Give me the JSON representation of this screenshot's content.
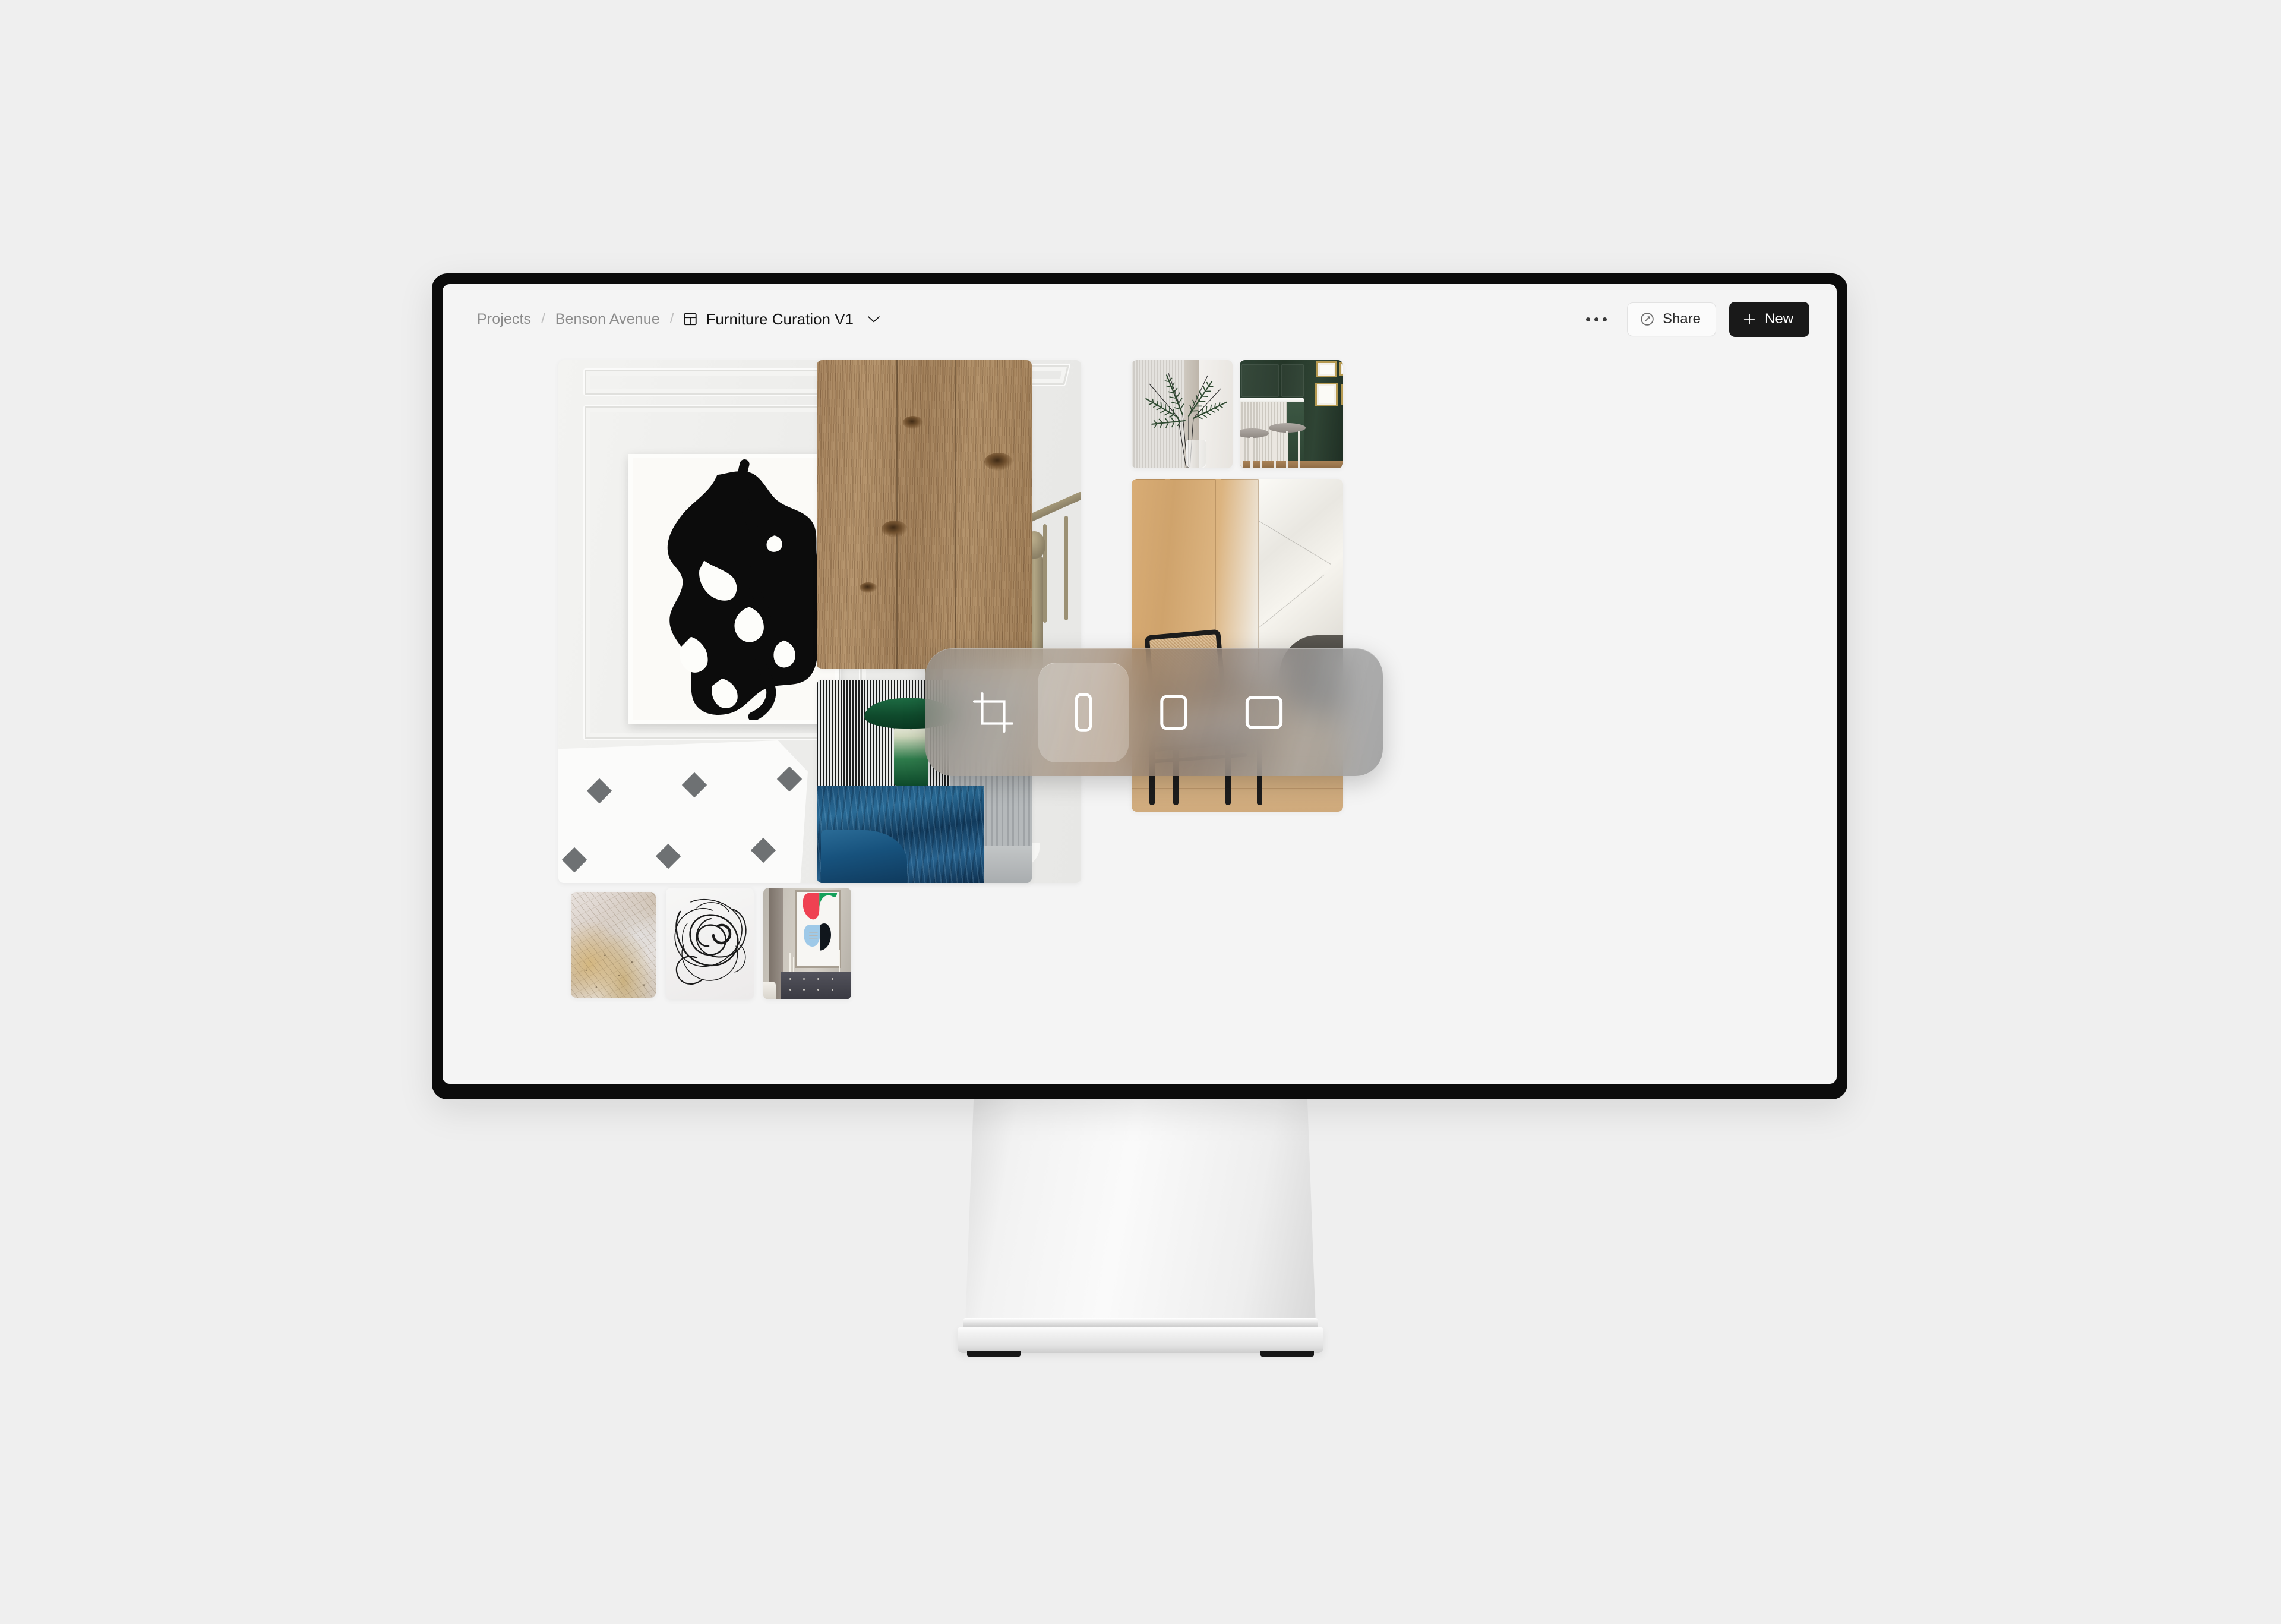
{
  "app": {
    "window_title": "Furniture Curation V1"
  },
  "topbar": {
    "breadcrumb": {
      "items": [
        {
          "label": "Projects",
          "current": false
        },
        {
          "label": "Benson Avenue",
          "current": false
        },
        {
          "label": "Furniture Curation V1",
          "current": true
        }
      ],
      "separator": "/",
      "current_icon": "layout-grid-icon",
      "dropdown_icon": "chevron-down-icon"
    },
    "more_menu": {
      "icon": "ellipsis-icon",
      "label": "More options"
    },
    "share": {
      "label": "Share",
      "icon": "link-icon"
    },
    "new": {
      "label": "New",
      "icon": "plus-icon",
      "background": "#191919",
      "text_color": "#ffffff"
    }
  },
  "floating_toolbar": {
    "items": [
      {
        "id": "crop",
        "icon": "crop-icon",
        "label": "Crop",
        "active": false
      },
      {
        "id": "ratio-tall",
        "icon": "rectangle-tall-icon",
        "label": "Tall aspect ratio",
        "active": true
      },
      {
        "id": "ratio-portrait",
        "icon": "rectangle-portrait-icon",
        "label": "Portrait aspect ratio",
        "active": false
      },
      {
        "id": "ratio-square",
        "icon": "rectangle-square-icon",
        "label": "Square aspect ratio",
        "active": false
      }
    ]
  },
  "board": {
    "cards": [
      {
        "id": "hall",
        "name": "white-hallway-interior",
        "alt": "White panelled hallway with large black abstract painting, brass wall sconce, brass staircase railing and diamond tile floor"
      },
      {
        "id": "wood",
        "name": "oak-wood-flooring-sample",
        "alt": "Light oak wood flooring plank sample with vertical grain"
      },
      {
        "id": "fern",
        "name": "fern-in-glass-vase",
        "alt": "Fern fronds in a clear glass vase against a fluted white wall"
      },
      {
        "id": "green",
        "name": "green-bar-nook",
        "alt": "Dark green bar nook with marble counter, fluted panelling, white stools and gold framed art"
      },
      {
        "id": "chair",
        "name": "cane-back-lounge-chair",
        "alt": "Black framed cane-back lounge chair with cream seat against oak panelling"
      },
      {
        "id": "blue",
        "name": "blue-marble-counter-green-lamp",
        "alt": "Green dome table lamp on a blue marble counter with striped backdrop"
      },
      {
        "id": "marble",
        "name": "gold-veined-marble-swatch",
        "alt": "Gold and cream veined marble stone swatch"
      },
      {
        "id": "scribble",
        "name": "wire-scribble-sculpture",
        "alt": "Black wire scribble sculpture on a light background"
      },
      {
        "id": "dresser",
        "name": "concrete-wall-dresser-vignette",
        "alt": "Concrete wall with colourful abstract artwork above a dark dresser with candlesticks"
      }
    ]
  },
  "monitor": {
    "bezel_color": "#0b0b0b",
    "screen_background": "#f4f4f4",
    "stand_name": "monitor-stand",
    "page_background": "#efefef"
  }
}
